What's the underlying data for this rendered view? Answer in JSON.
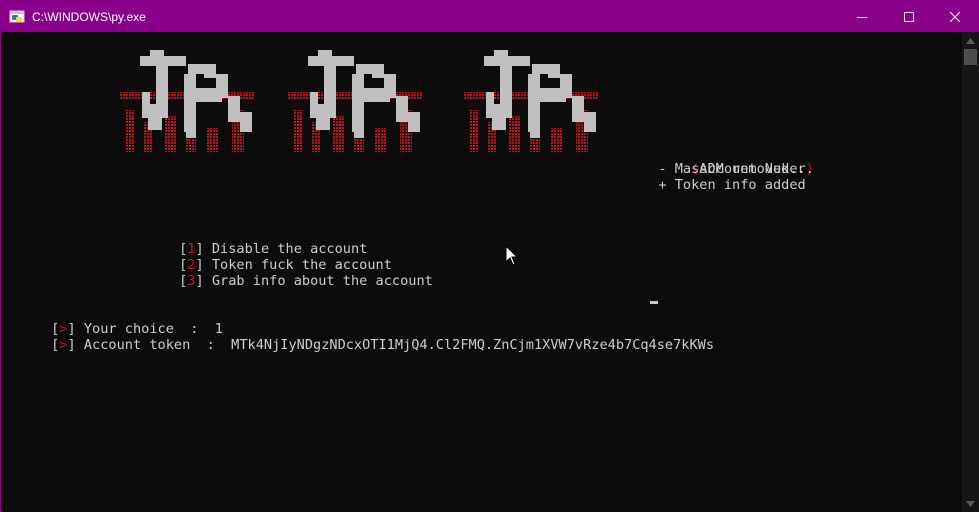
{
  "window": {
    "title": "C:\\WINDOWS\\py.exe",
    "accent_color": "#8b008b",
    "controls": [
      "minimize-icon",
      "maximize-icon",
      "close-icon"
    ]
  },
  "banner": {
    "word": "JA",
    "repeat": 3,
    "glyph_color": "#c0c0c0",
    "shadow_color": "#c50f1f"
  },
  "info": {
    "open_paren": "(",
    "title": "Account Nuker",
    "close_paren": ")",
    "notes": [
      "  - MassDM removed...",
      "  + Token info added"
    ]
  },
  "menu": [
    {
      "open": "[",
      "key": "1",
      "close": "]",
      "label": " Disable the account"
    },
    {
      "open": "[",
      "key": "2",
      "close": "]",
      "label": " Token fuck the account"
    },
    {
      "open": "[",
      "key": "3",
      "close": "]",
      "label": " Grab info about the account"
    }
  ],
  "prompts": [
    {
      "open": "[",
      "sym": ">",
      "close": "]",
      "label": " Your choice  :  1"
    },
    {
      "open": "[",
      "sym": ">",
      "close": "]",
      "label": " Account token  :  MTk4NjIyNDgzNDcxOTI1MjQ4.Cl2FMQ.ZnCjm1XVW7vRze4b7Cq4se7kKWs"
    }
  ],
  "colors": {
    "console_bg": "#0c0c0c",
    "console_fg": "#cccccc",
    "highlight": "#c50f1f"
  }
}
